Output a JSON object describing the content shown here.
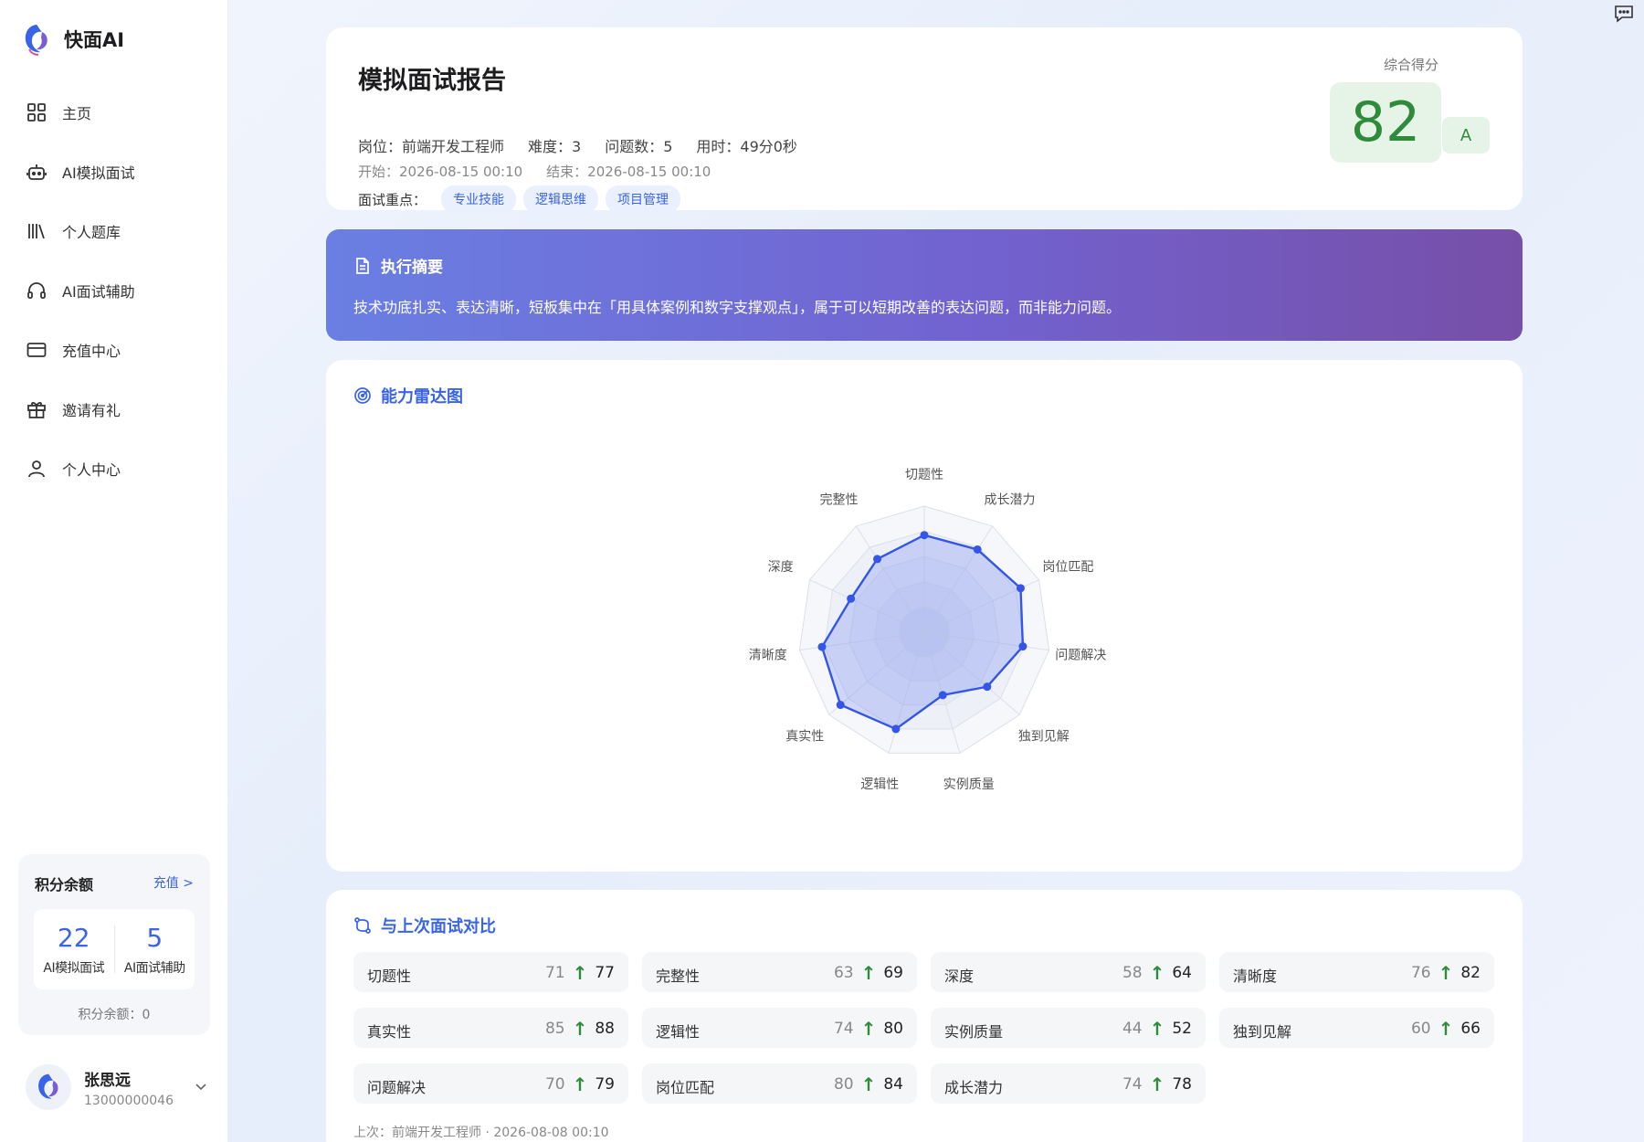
{
  "brand": {
    "name": "快面AI"
  },
  "nav": [
    {
      "label": "主页",
      "icon": "grid-icon"
    },
    {
      "label": "AI模拟面试",
      "icon": "robot-icon"
    },
    {
      "label": "个人题库",
      "icon": "library-icon"
    },
    {
      "label": "AI面试辅助",
      "icon": "headphones-icon"
    },
    {
      "label": "充值中心",
      "icon": "card-icon"
    },
    {
      "label": "邀请有礼",
      "icon": "gift-icon"
    },
    {
      "label": "个人中心",
      "icon": "user-icon"
    }
  ],
  "points": {
    "title": "积分余额",
    "link": "充值 >",
    "mock_count": "22",
    "mock_label": "AI模拟面试",
    "assist_count": "5",
    "assist_label": "AI面试辅助",
    "balance": "积分余额：0"
  },
  "user": {
    "name": "张思远",
    "phone": "13000000046"
  },
  "report": {
    "title": "模拟面试报告",
    "position": "岗位：前端开发工程师",
    "difficulty": "难度：3",
    "questions": "问题数：5",
    "duration": "用时：49分0秒",
    "start": "开始：2026-08-15 00:10",
    "end": "结束：2026-08-15 00:10",
    "focus_label": "面试重点：",
    "tags": [
      "专业技能",
      "逻辑思维",
      "项目管理"
    ],
    "score_label": "综合得分",
    "score": "82",
    "grade": "A"
  },
  "summary": {
    "title": "执行摘要",
    "text": "技术功底扎实、表达清晰，短板集中在「用具体案例和数字支撑观点」，属于可以短期改善的表达问题，而非能力问题。"
  },
  "radar": {
    "title": "能力雷达图"
  },
  "chart_data": {
    "type": "radar",
    "categories": [
      "切题性",
      "成长潜力",
      "岗位匹配",
      "问题解决",
      "独到见解",
      "实例质量",
      "逻辑性",
      "真实性",
      "清晰度",
      "深度",
      "完整性"
    ],
    "values": [
      77,
      78,
      84,
      79,
      66,
      52,
      80,
      88,
      82,
      64,
      69
    ],
    "range": [
      0,
      100
    ],
    "color": "#3355e8"
  },
  "compare": {
    "title": "与上次面试对比",
    "items": [
      {
        "name": "切题性",
        "old": "71",
        "new": "77"
      },
      {
        "name": "完整性",
        "old": "63",
        "new": "69"
      },
      {
        "name": "深度",
        "old": "58",
        "new": "64"
      },
      {
        "name": "清晰度",
        "old": "76",
        "new": "82"
      },
      {
        "name": "真实性",
        "old": "85",
        "new": "88"
      },
      {
        "name": "逻辑性",
        "old": "74",
        "new": "80"
      },
      {
        "name": "实例质量",
        "old": "44",
        "new": "52"
      },
      {
        "name": "独到见解",
        "old": "60",
        "new": "66"
      },
      {
        "name": "问题解决",
        "old": "70",
        "new": "79"
      },
      {
        "name": "岗位匹配",
        "old": "80",
        "new": "84"
      },
      {
        "name": "成长潜力",
        "old": "74",
        "new": "78"
      }
    ],
    "previous": "上次：前端开发工程师 · 2026-08-08 00:10"
  },
  "colors": {
    "accent": "#3a64e8",
    "score": "#2e8b3a",
    "score_bg": "#e6f4e7"
  }
}
